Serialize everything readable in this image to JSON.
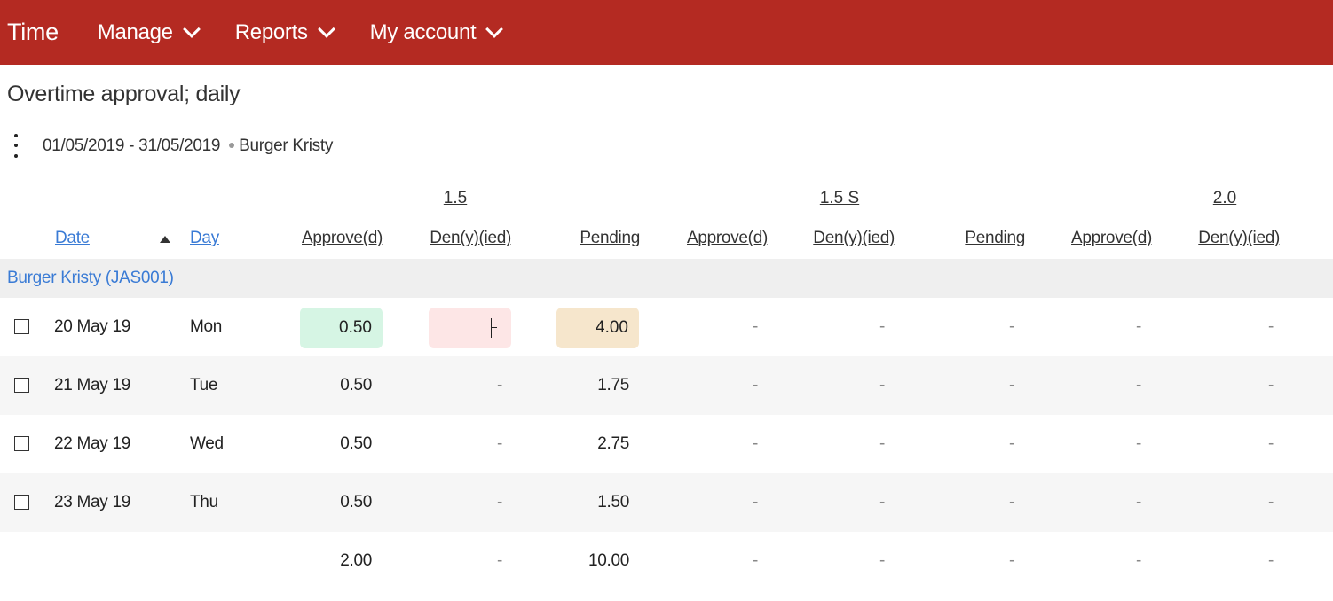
{
  "header": {
    "brand": "Time",
    "menu": [
      {
        "label": "Manage"
      },
      {
        "label": "Reports"
      },
      {
        "label": "My account"
      }
    ]
  },
  "page": {
    "title": "Overtime approval; daily",
    "date_range": "01/05/2019 - 31/05/2019",
    "employee": "Burger Kristy"
  },
  "column_groups": [
    "1.5",
    "1.5 S",
    "2.0"
  ],
  "columns": {
    "date": "Date",
    "day": "Day",
    "g1_approve": "Approve(d)",
    "g1_deny": "Den(y)(ied)",
    "g1_pending": "Pending",
    "g2_approve": "Approve(d)",
    "g2_deny": "Den(y)(ied)",
    "g2_pending": "Pending",
    "g3_approve": "Approve(d)",
    "g3_deny": "Den(y)(ied)"
  },
  "group_row": "Burger Kristy (JAS001)",
  "rows": [
    {
      "date": "20 May 19",
      "day": "Mon",
      "approve": "0.50",
      "deny": "",
      "pending": "4.00",
      "c4": "-",
      "c5": "-",
      "c6": "-",
      "c7": "-",
      "c8": "-"
    },
    {
      "date": "21 May 19",
      "day": "Tue",
      "approve": "0.50",
      "deny": "-",
      "pending": "1.75",
      "c4": "-",
      "c5": "-",
      "c6": "-",
      "c7": "-",
      "c8": "-"
    },
    {
      "date": "22 May 19",
      "day": "Wed",
      "approve": "0.50",
      "deny": "-",
      "pending": "2.75",
      "c4": "-",
      "c5": "-",
      "c6": "-",
      "c7": "-",
      "c8": "-"
    },
    {
      "date": "23 May 19",
      "day": "Thu",
      "approve": "0.50",
      "deny": "-",
      "pending": "1.50",
      "c4": "-",
      "c5": "-",
      "c6": "-",
      "c7": "-",
      "c8": "-"
    }
  ],
  "totals": {
    "approve": "2.00",
    "deny": "-",
    "pending": "10.00",
    "c4": "-",
    "c5": "-",
    "c6": "-",
    "c7": "-",
    "c8": "-"
  },
  "colors": {
    "header_bg": "#b42a22",
    "link": "#3a7bd5",
    "approve_bg": "#d6f5e4",
    "deny_bg": "#fde6e6",
    "pending_bg": "#f6e6cc"
  }
}
